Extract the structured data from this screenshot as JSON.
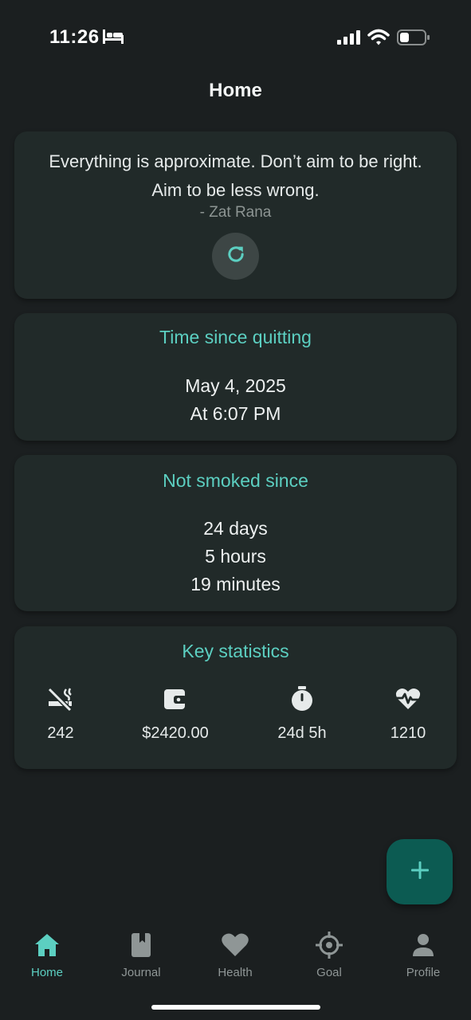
{
  "status_bar": {
    "time": "11:26",
    "icons": [
      "bed-icon",
      "signal-icon",
      "wifi-icon",
      "battery-icon"
    ]
  },
  "header": {
    "title": "Home"
  },
  "quote": {
    "text": "Everything is approximate. Don’t aim to be right. Aim to be less wrong.",
    "author": "- Zat Rana",
    "refresh_icon": "refresh-icon"
  },
  "quit_time": {
    "title": "Time since quitting",
    "date": "May 4, 2025",
    "time": "At 6:07 PM"
  },
  "not_smoked": {
    "title": "Not smoked since",
    "days": "24 days",
    "hours": "5 hours",
    "minutes": "19 minutes"
  },
  "key_stats": {
    "title": "Key statistics",
    "items": [
      {
        "icon": "no-smoking-icon",
        "value": "242"
      },
      {
        "icon": "wallet-icon",
        "value": "$2420.00"
      },
      {
        "icon": "stopwatch-icon",
        "value": "24d 5h"
      },
      {
        "icon": "heartbeat-icon",
        "value": "1210"
      }
    ]
  },
  "fab": {
    "icon": "plus-icon"
  },
  "nav": {
    "items": [
      {
        "label": "Home",
        "icon": "home-icon",
        "active": true
      },
      {
        "label": "Journal",
        "icon": "journal-icon",
        "active": false
      },
      {
        "label": "Health",
        "icon": "heart-icon",
        "active": false
      },
      {
        "label": "Goal",
        "icon": "crosshair-icon",
        "active": false
      },
      {
        "label": "Profile",
        "icon": "person-icon",
        "active": false
      }
    ]
  },
  "colors": {
    "background": "#1b1f20",
    "card": "#212a29",
    "accent": "#5ccfc1",
    "fab": "#0c5b52",
    "inactive": "#8f9696"
  }
}
